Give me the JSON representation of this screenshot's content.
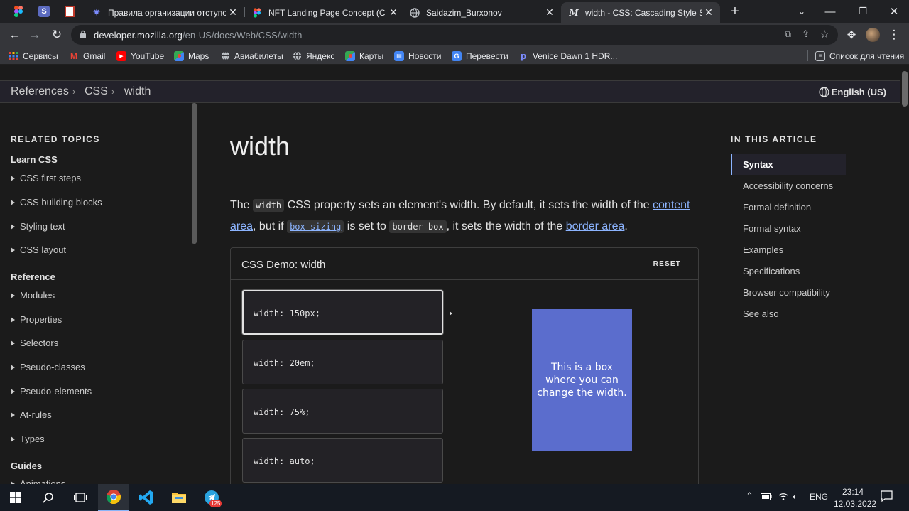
{
  "browser": {
    "tabs": [
      {
        "title": "Правила организации отступов",
        "icon": "snowflake-icon"
      },
      {
        "title": "NFT Landing Page Concept (Com",
        "icon": "figma-icon"
      },
      {
        "title": "Saidazim_Burxonov",
        "icon": "globe-icon"
      },
      {
        "title": "width - CSS: Cascading Style She",
        "icon": "mdn-icon",
        "active": true
      }
    ],
    "url_host": "developer.mozilla.org",
    "url_path": "/en-US/docs/Web/CSS/width",
    "bookmarks": [
      {
        "label": "Сервисы",
        "icon": "apps-grid-icon"
      },
      {
        "label": "Gmail",
        "icon": "gmail-icon"
      },
      {
        "label": "YouTube",
        "icon": "youtube-icon"
      },
      {
        "label": "Maps",
        "icon": "maps-icon"
      },
      {
        "label": "Авиабилеты",
        "icon": "globe-icon"
      },
      {
        "label": "Яндекс",
        "icon": "globe-icon"
      },
      {
        "label": "Карты",
        "icon": "maps-icon"
      },
      {
        "label": "Новости",
        "icon": "news-icon"
      },
      {
        "label": "Перевести",
        "icon": "translate-icon"
      },
      {
        "label": "Venice Dawn 1 HDR...",
        "icon": "bookmark-icon"
      }
    ],
    "reading_list": "Список для чтения"
  },
  "breadcrumbs": {
    "items": [
      "References",
      "CSS",
      "width"
    ],
    "language": "English (US)"
  },
  "sidebar": {
    "heading": "RELATED TOPICS",
    "group_learn": "Learn CSS",
    "learn_items": [
      "CSS first steps",
      "CSS building blocks",
      "Styling text",
      "CSS layout"
    ],
    "group_reference": "Reference",
    "reference_items": [
      "Modules",
      "Properties",
      "Selectors",
      "Pseudo-classes",
      "Pseudo-elements",
      "At-rules",
      "Types"
    ],
    "group_guides": "Guides",
    "guides_items": [
      "Animations"
    ]
  },
  "article": {
    "title": "width",
    "intro": {
      "p1": "The ",
      "code_width": "width",
      "p2": " CSS property sets an element's width. By default, it sets the width of the ",
      "link_content_area": "content area",
      "p3": ", but if ",
      "code_box_sizing": "box-sizing",
      "p4": " is set to ",
      "code_border_box": "border-box",
      "p5": ", it sets the width of the ",
      "link_border_area": "border area",
      "p6": "."
    }
  },
  "demo": {
    "title": "CSS Demo: width",
    "reset_label": "RESET",
    "choices": [
      "width: 150px;",
      "width: 20em;",
      "width: 75%;",
      "width: auto;"
    ],
    "selected_index": 0,
    "box_text": "This is a box where you can change the width.",
    "box_color": "#5b6dcd"
  },
  "toc": {
    "heading": "IN THIS ARTICLE",
    "items": [
      "Syntax",
      "Accessibility concerns",
      "Formal definition",
      "Formal syntax",
      "Examples",
      "Specifications",
      "Browser compatibility",
      "See also"
    ],
    "active_index": 0
  },
  "taskbar": {
    "language": "ENG",
    "time": "23:14",
    "date": "12.03.2022",
    "telegram_badge": "125"
  },
  "colors": {
    "page_bg": "#1b1b1b",
    "link": "#8cb4ff",
    "chrome_bg": "#202124"
  }
}
